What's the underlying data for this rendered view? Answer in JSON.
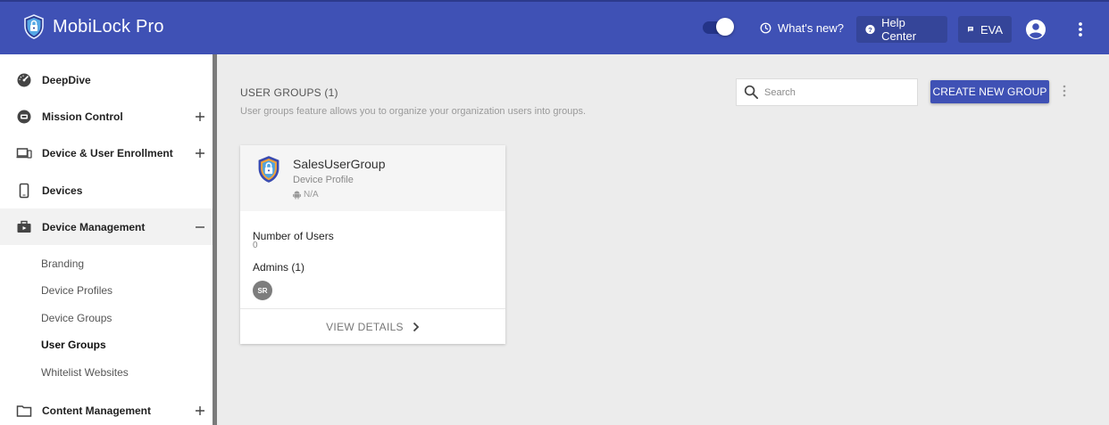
{
  "app": {
    "title": "MobiLock Pro"
  },
  "header": {
    "whats_new": "What's new?",
    "help_center": "Help Center",
    "eva": "EVA",
    "toggle_on": true
  },
  "sidebar": {
    "items": [
      {
        "label": "DeepDive",
        "icon": "speedometer-icon",
        "expandable": false
      },
      {
        "label": "Mission Control",
        "icon": "mission-control-icon",
        "expandable": true
      },
      {
        "label": "Device & User Enrollment",
        "icon": "devices-icon",
        "expandable": true
      },
      {
        "label": "Devices",
        "icon": "phone-icon",
        "expandable": false
      },
      {
        "label": "Device Management",
        "icon": "briefcase-icon",
        "expandable": true,
        "expanded": true
      }
    ],
    "subitems": [
      "Branding",
      "Device Profiles",
      "Device Groups",
      "User Groups",
      "Whitelist Websites"
    ],
    "active_subitem": "User Groups",
    "footer_item": {
      "label": "Content Management",
      "icon": "folder-icon"
    }
  },
  "main": {
    "title": "USER GROUPS (1)",
    "subtitle": "User groups feature allows you to organize your organization users into groups.",
    "search_placeholder": "Search",
    "create_button": "CREATE NEW GROUP"
  },
  "card": {
    "name": "SalesUserGroup",
    "profile_type": "Device Profile",
    "os": "N/A",
    "users_label": "Number of Users",
    "users_count": "0",
    "admins_label": "Admins (1)",
    "admin_initials": "SR",
    "view_details": "VIEW DETAILS"
  },
  "colors": {
    "header": "#3f51b5",
    "accent": "#3f51b5",
    "background": "#ececec"
  }
}
